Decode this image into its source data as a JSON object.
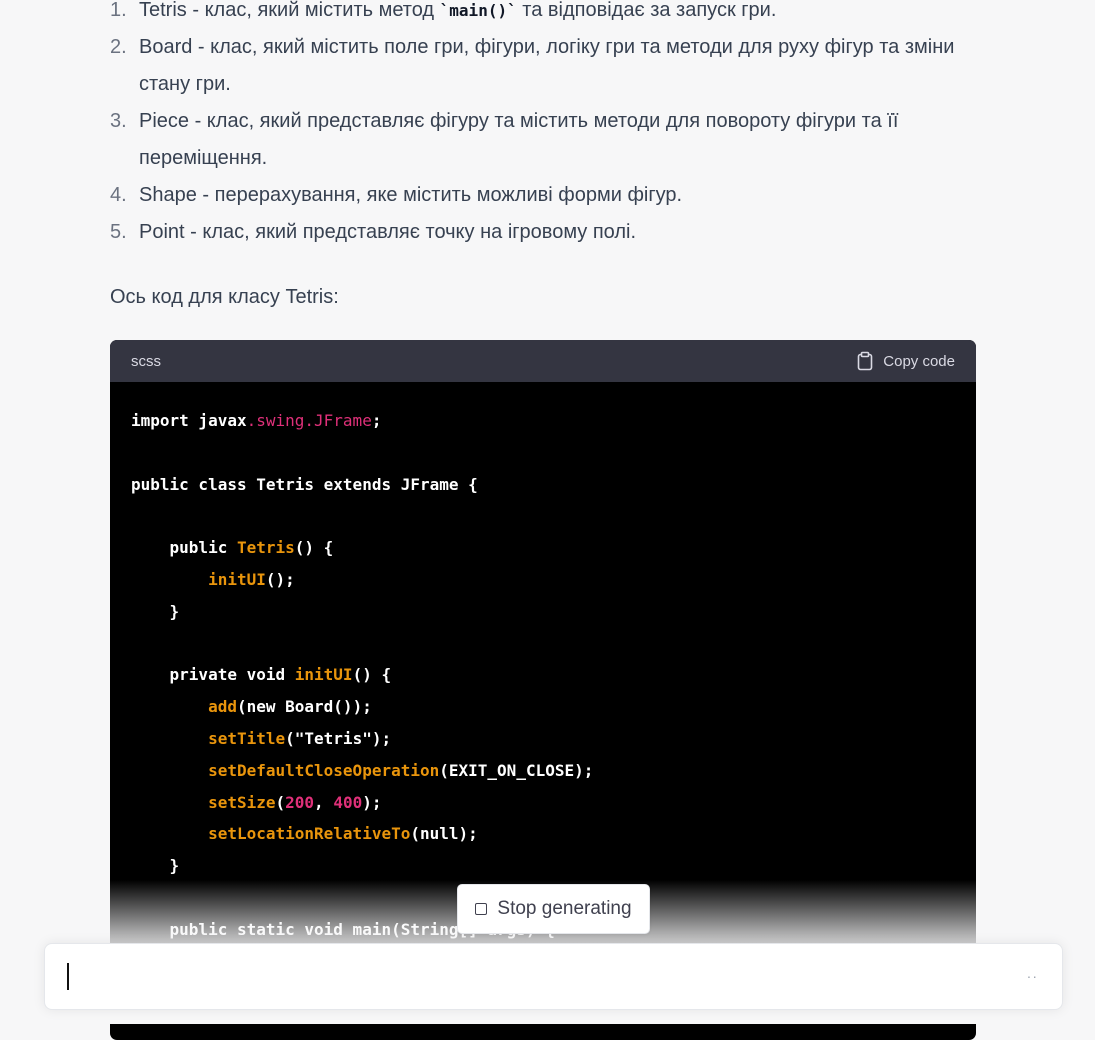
{
  "steps": [
    {
      "num": "1.",
      "name": "Tetris",
      "text_before": " - клас, який містить метод ",
      "code": "`main()`",
      "text_after": " та відповідає за запуск гри."
    },
    {
      "num": "2.",
      "name": "Board",
      "text_before": " - клас, який містить поле гри, фігури, логіку гри та методи для руху фігур та зміни стану гри.",
      "code": "",
      "text_after": ""
    },
    {
      "num": "3.",
      "name": "Piece",
      "text_before": " - клас, який представляє фігуру та містить методи для повороту фігури та її переміщення.",
      "code": "",
      "text_after": ""
    },
    {
      "num": "4.",
      "name": "Shape",
      "text_before": " - перерахування, яке містить можливі форми фігур.",
      "code": "",
      "text_after": ""
    },
    {
      "num": "5.",
      "name": "Point",
      "text_before": " - клас, який представляє точку на ігровому полі.",
      "code": "",
      "text_after": ""
    }
  ],
  "intro_text": "Ось код для класу Tetris:",
  "code_block": {
    "language": "scss",
    "copy_label": "Copy code",
    "copy_icon": "clipboard-icon",
    "lines": [
      "import javax.swing.JFrame;",
      "",
      "public class Tetris extends JFrame {",
      "",
      "    public Tetris() {",
      "        initUI();",
      "    }",
      "",
      "    private void initUI() {",
      "        add(new Board());",
      "        setTitle(\"Tetris\");",
      "        setDefaultCloseOperation(EXIT_ON_CLOSE);",
      "        setSize(200, 400);",
      "        setLocationRelativeTo(null);",
      "    }",
      "",
      "    public static void main(String[] args) {"
    ]
  },
  "stop_button": {
    "label": "Stop generating",
    "icon": "stop-square-icon"
  },
  "prompt_input": {
    "value": "",
    "more_icon": "ellipsis-icon"
  },
  "colors": {
    "page_bg": "#f7f7f8",
    "code_bg": "#000000",
    "code_header_bg": "#343541",
    "syntax_property": "#df3079",
    "syntax_function": "#e9950c"
  }
}
